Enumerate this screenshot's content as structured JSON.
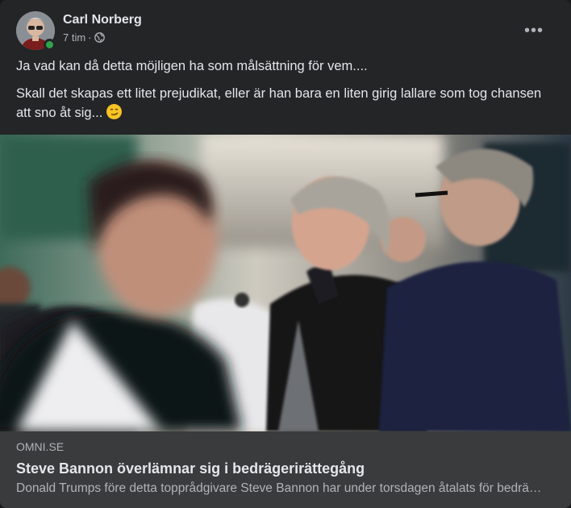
{
  "post": {
    "author": "Carl Norberg",
    "time": "7 tim",
    "separator": "·",
    "privacy_icon": "globe-icon",
    "more_icon": "more-options-icon",
    "paragraphs": [
      "Ja vad kan då detta möjligen ha som målsättning för vem....",
      "Skall det skapas ett litet prejudikat, eller är han bara en liten girig lallare som tog chansen att sno åt sig..."
    ],
    "emoji": "smirk-face-emoji"
  },
  "link": {
    "domain": "OMNI.SE",
    "title": "Steve Bannon överlämnar sig i bedrägerirättegång",
    "description": "Donald Trumps före detta topprådgivare Steve Bannon har under torsdagen åtalats för bedrägeri"
  },
  "colors": {
    "card_bg": "#242526",
    "footer_bg": "#3a3b3c",
    "primary_text": "#e4e6eb",
    "secondary_text": "#b0b3b8",
    "online": "#31a24c"
  }
}
